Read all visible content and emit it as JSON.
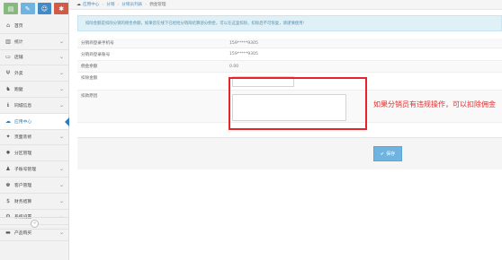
{
  "sidebar": {
    "shortcuts": [
      {
        "icon": "chart-icon",
        "glyph": "▤"
      },
      {
        "icon": "pencil-icon",
        "glyph": "✎"
      },
      {
        "icon": "users-icon",
        "glyph": "☺"
      },
      {
        "icon": "cogs-icon",
        "glyph": "✱"
      }
    ],
    "items": [
      {
        "label": "首页",
        "icon": "home-icon",
        "glyph": "⌂",
        "chevron": false
      },
      {
        "label": "统计",
        "icon": "bar-chart-icon",
        "glyph": "▥",
        "chevron": true
      },
      {
        "label": "店铺",
        "icon": "desktop-icon",
        "glyph": "▭",
        "chevron": true
      },
      {
        "label": "外卖",
        "icon": "utensils-icon",
        "glyph": "Ψ",
        "chevron": true
      },
      {
        "label": "跑腿",
        "icon": "bike-icon",
        "glyph": "♞",
        "chevron": true
      },
      {
        "label": "同城信息",
        "icon": "info-icon",
        "glyph": "ℹ",
        "chevron": true
      },
      {
        "label": "应用中心",
        "icon": "cloud-icon",
        "glyph": "☁",
        "chevron": false,
        "active": true
      },
      {
        "label": "页面装修",
        "icon": "paint-icon",
        "glyph": "✦",
        "chevron": true
      },
      {
        "label": "分区管理",
        "icon": "zone-icon",
        "glyph": "✹",
        "chevron": false
      },
      {
        "label": "子账号管理",
        "icon": "user-icon",
        "glyph": "♟",
        "chevron": true
      },
      {
        "label": "客户管理",
        "icon": "customers-icon",
        "glyph": "♚",
        "chevron": true
      },
      {
        "label": "财务结算",
        "icon": "dollar-icon",
        "glyph": "$",
        "chevron": true
      },
      {
        "label": "系统设置",
        "icon": "gear-icon",
        "glyph": "⚙",
        "chevron": true
      },
      {
        "label": "产品购买",
        "icon": "briefcase-icon",
        "glyph": "▬",
        "chevron": true
      }
    ],
    "collapse_glyph": "«"
  },
  "breadcrumb": {
    "items": [
      "应用中心",
      "分销",
      "分销员列表"
    ],
    "current": "佣金管理"
  },
  "notice": "扣除金额是扣除分销的佣金余额，如果您在线下已经给分销商结算部分佣金，可以在这里扣除，扣除后不可恢复，请谨慎使用!",
  "form": {
    "phone": {
      "label": "分销商登录手机号",
      "value": "159*****9305"
    },
    "account": {
      "label": "分销商登录账号",
      "value": "159*****9305"
    },
    "balance": {
      "label": "佣金余额",
      "value": "0.00"
    },
    "deduct_amount": {
      "label": "扣除金额",
      "value": ""
    },
    "deduct_reason": {
      "label": "扣款原因",
      "value": ""
    }
  },
  "annotation": "如果分销员有违规操作，可以扣除佣金",
  "save_button": {
    "label": "保存",
    "glyph": "✔"
  },
  "colors": {
    "annotation_red": "#e8232b",
    "save_blue": "#6fb3e0",
    "active_blue": "#2b7dbc"
  }
}
